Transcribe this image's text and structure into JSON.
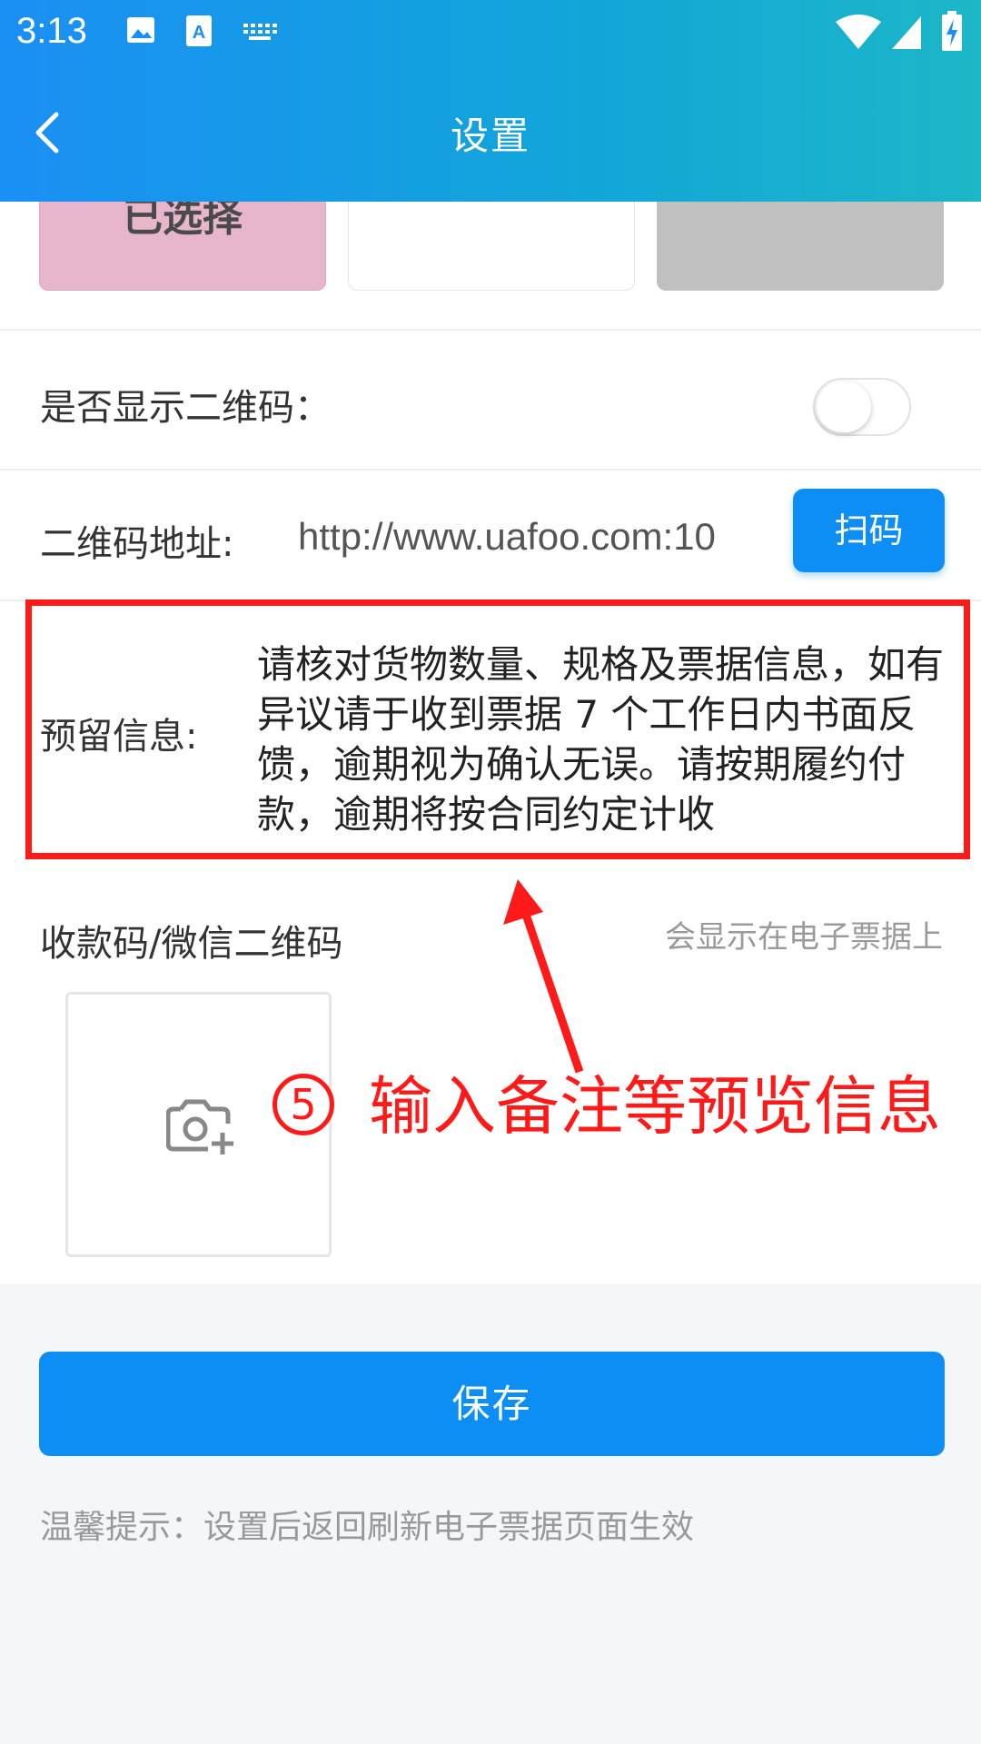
{
  "status_bar": {
    "time": "3:13",
    "icons": [
      "image-icon",
      "text-icon",
      "keyboard-icon",
      "wifi-icon",
      "signal-icon",
      "battery-icon"
    ]
  },
  "header": {
    "title": "设置",
    "background_color": "#1a8ff5"
  },
  "tiles": {
    "selected_label": "已选择"
  },
  "qr_display": {
    "label": "是否显示二维码：",
    "enabled": false
  },
  "qr_url": {
    "label": "二维码地址:",
    "value": "http://www.uafoo.com:10",
    "scan_label": "扫码"
  },
  "note": {
    "label": "预留信息:",
    "value": "请核对货物数量、规格及票据信息，如有异议请于收到票据 7 个工作日内书面反馈，逾期视为确认无误。请按期履约付款，逾期将按合同约定计收"
  },
  "payment": {
    "label": "收款码/微信二维码",
    "hint": "会显示在电子票据上"
  },
  "annotation": {
    "number": "5",
    "text": "输入备注等预览信息",
    "color": "#ff1a1a"
  },
  "save_label": "保存",
  "tip": "温馨提示：设置后返回刷新电子票据页面生效",
  "accent_color": "#0d8ef5"
}
